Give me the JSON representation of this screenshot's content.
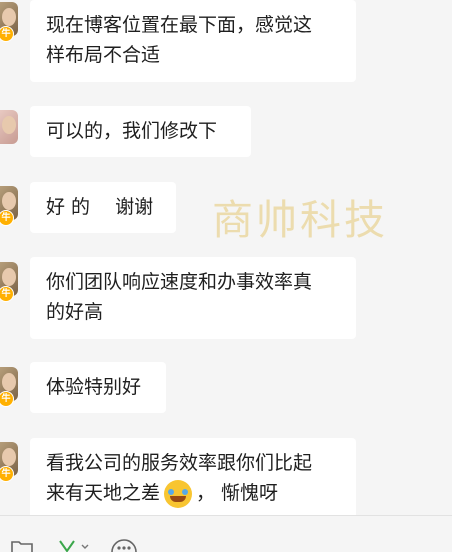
{
  "watermark": "商帅科技",
  "messages": [
    {
      "text_lines": [
        "现在博客位置在最下面，感觉这",
        "样布局不合适"
      ]
    },
    {
      "text_lines": [
        "可以的，我们修改下"
      ]
    },
    {
      "text_lines": [
        "好 的　 谢谢"
      ]
    },
    {
      "text_lines": [
        "你们团队响应速度和办事效率真",
        "的好高"
      ]
    },
    {
      "text_lines": [
        "体验特别好"
      ]
    },
    {
      "text_lines": [
        "看我公司的服务效率跟你们比起",
        "来有天地之差"
      ],
      "trailing": "， 惭愧呀",
      "emoji": "crying-laughing-emoji"
    }
  ],
  "badge_symbol": "牛",
  "toolbar": {
    "icons": [
      "folder-icon",
      "v-chevron-icon",
      "chat-bubble-icon"
    ]
  }
}
